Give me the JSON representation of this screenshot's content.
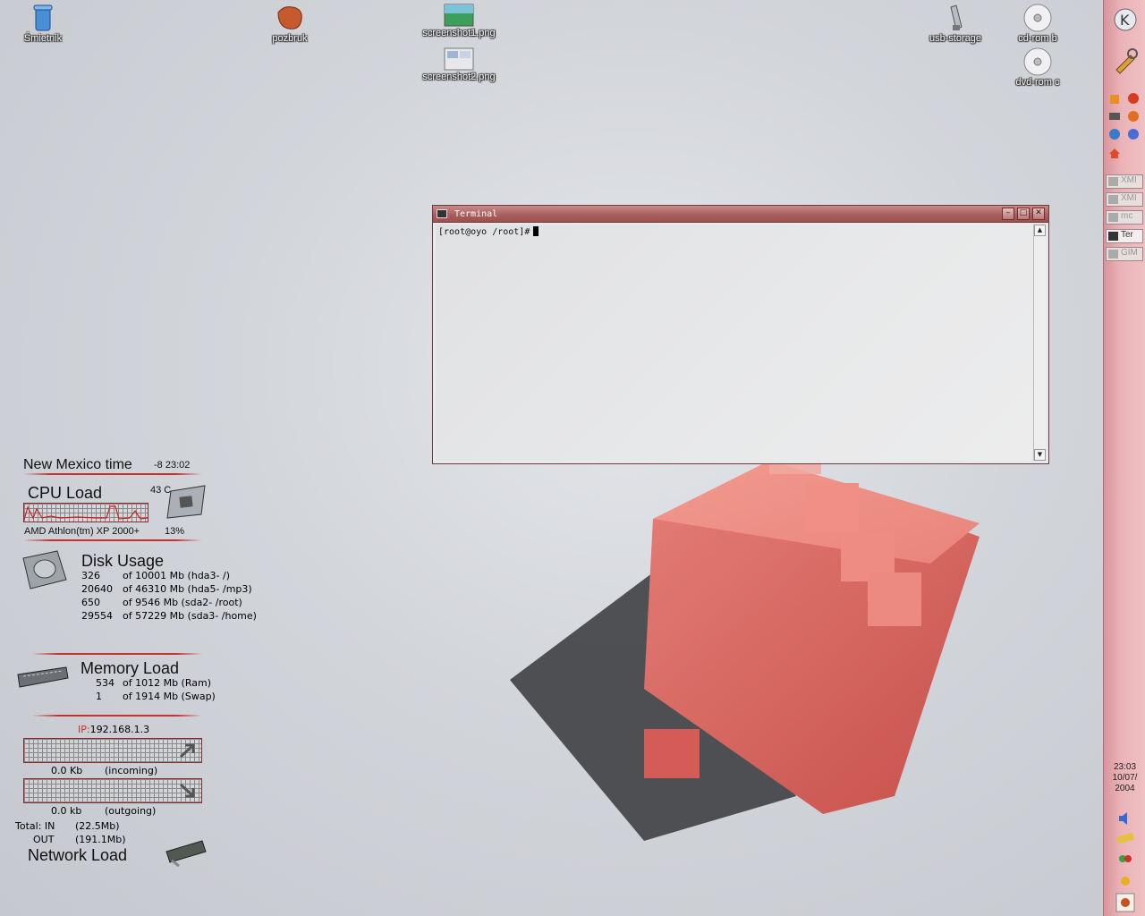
{
  "desktop": {
    "icons": [
      {
        "label": "Śmietnik",
        "icon": "trash-icon"
      },
      {
        "label": "pozbruk",
        "icon": "brick-icon"
      },
      {
        "label": "screenshot1.png",
        "icon": "image-file-icon"
      },
      {
        "label": "screenshot2.png",
        "icon": "image-file-icon"
      },
      {
        "label": "usb-storage",
        "icon": "usb-icon"
      },
      {
        "label": "cd-rom b",
        "icon": "cdrom-icon"
      },
      {
        "label": "dvd-rom c",
        "icon": "dvdrom-icon"
      }
    ]
  },
  "terminal": {
    "title": "Terminal",
    "prompt": "[root@oyo /root]#",
    "buttons": {
      "minimize": "–",
      "maximize": "□",
      "close": "✕"
    }
  },
  "widgets": {
    "time": {
      "label": "New Mexico time",
      "value": "-8 23:02"
    },
    "cpu": {
      "title": "CPU Load",
      "temp": "43 C",
      "model": "AMD Athlon(tm) XP 2000+",
      "load": "13%"
    },
    "disk": {
      "title": "Disk Usage",
      "rows": [
        {
          "used": "326",
          "desc": "of 10001 Mb (hda3- /)"
        },
        {
          "used": "20640",
          "desc": "of 46310 Mb (hda5- /mp3)"
        },
        {
          "used": "650",
          "desc": "of 9546 Mb (sda2- /root)"
        },
        {
          "used": "29554",
          "desc": "of 57229 Mb (sda3- /home)"
        }
      ]
    },
    "memory": {
      "title": "Memory Load",
      "rows": [
        {
          "used": "534",
          "desc": "of 1012 Mb (Ram)"
        },
        {
          "used": "1",
          "desc": "of 1914 Mb (Swap)"
        }
      ]
    },
    "network": {
      "ip_label": "IP:",
      "ip": "192.168.1.3",
      "incoming_value": "0.0 Kb",
      "incoming_label": "(incoming)",
      "outgoing_value": "0.0 kb",
      "outgoing_label": "(outgoing)",
      "total_in_label": "Total: IN",
      "total_in": "(22.5Mb)",
      "total_out_label": "OUT",
      "total_out": "(191.1Mb)",
      "title": "Network Load"
    }
  },
  "panel": {
    "tasks": [
      "XMI",
      "XMI",
      "mc",
      "Ter",
      "GIM"
    ],
    "clock": {
      "time": "23:03",
      "date": "10/07/",
      "year": "2004"
    }
  },
  "colors": {
    "accent": "#c83030",
    "panel": "#eab3b7",
    "titlebar": "#a95c5c"
  }
}
